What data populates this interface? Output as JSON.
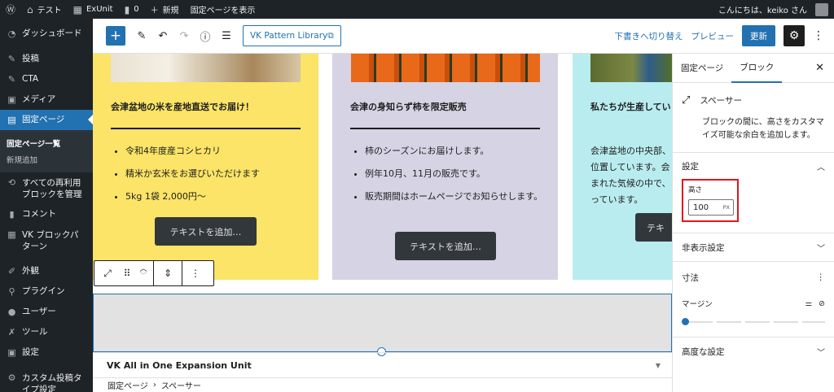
{
  "adminbar": {
    "site_name": "テスト",
    "exunit": "ExUnit",
    "comments": "0",
    "new": "新規",
    "view_page": "固定ページを表示",
    "greeting": "こんにちは、keiko さん"
  },
  "sidebar": {
    "dashboard": "ダッシュボード",
    "posts": "投稿",
    "cta": "CTA",
    "media": "メディア",
    "pages": "固定ページ",
    "pages_all": "固定ページ一覧",
    "pages_new": "新規追加",
    "reusable": "すべての再利用ブロックを管理",
    "comments": "コメント",
    "vk_patterns": "VK ブロックパターン",
    "appearance": "外観",
    "plugins": "プラグイン",
    "users": "ユーザー",
    "tools": "ツール",
    "settings": "設定",
    "cpt": "カスタム投稿タイプ設定"
  },
  "toolbar": {
    "pattern_library": "VK Pattern Library",
    "save_draft": "下書きへ切り替え",
    "preview": "プレビュー",
    "update": "更新"
  },
  "canvas": {
    "columns": [
      {
        "title": "会津盆地の米を産地直送でお届け！",
        "items": [
          "令和4年度産コシヒカリ",
          "精米か玄米をお選びいただけます",
          "5kg 1袋 2,000円〜"
        ],
        "button": "テキストを追加…"
      },
      {
        "title": "会津の身知らず柿を限定販売",
        "items": [
          "柿のシーズンにお届けします。",
          "例年10月、11月の販売です。",
          "販売期間はホームページでお知らせします。"
        ],
        "button": "テキストを追加…"
      },
      {
        "title": "私たちが生産してい",
        "paragraph": "会津盆地の中央部、\n位置しています。会\nまれた気候の中で、\nっています。",
        "button": "テキ"
      }
    ],
    "meta_box_title": "VK All in One Expansion Unit"
  },
  "breadcrumb": {
    "root": "固定ページ",
    "separator": "›",
    "current": "スペーサー"
  },
  "panel": {
    "tab_page": "固定ページ",
    "tab_block": "ブロック",
    "block_name": "スペーサー",
    "block_desc": "ブロックの間に、高さをカスタマイズ可能な余白を追加します。",
    "settings_title": "設定",
    "height_label": "高さ",
    "height_value": "100",
    "height_unit": "PX",
    "hidden_settings": "非表示設定",
    "dimensions": "寸法",
    "margin": "マージン",
    "margin_value": 0,
    "advanced": "高度な設定"
  }
}
